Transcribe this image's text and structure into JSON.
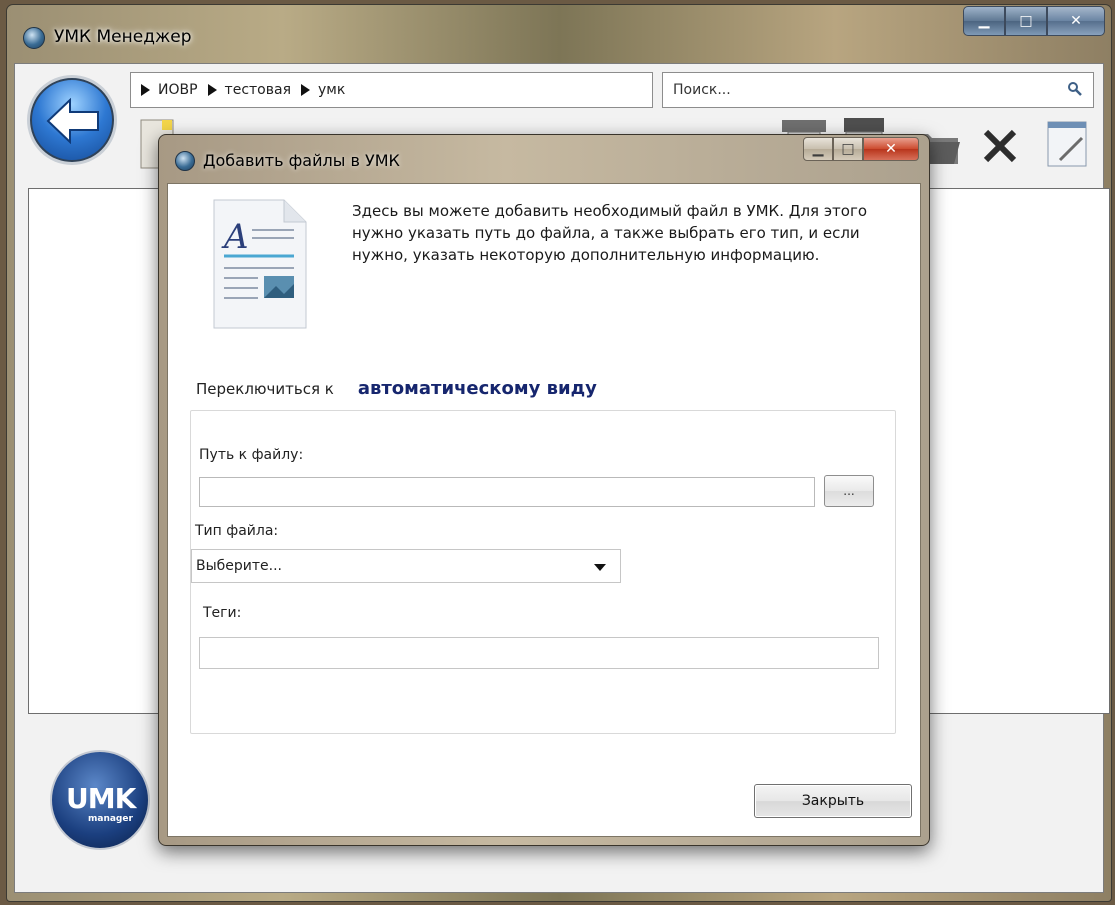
{
  "window": {
    "title": "УМК Менеджер"
  },
  "nav": {
    "crumbs": [
      "ИОВР",
      "тестовая",
      "умк"
    ],
    "search_placeholder": "Поиск..."
  },
  "logo": {
    "text": "UMK",
    "sub": "manager"
  },
  "dialog": {
    "title": "Добавить файлы в УМК",
    "intro": "Здесь вы можете добавить необходимый файл в УМК. Для этого нужно указать путь до файла, а также выбрать его тип, и если нужно, указать некоторую дополнительную информацию.",
    "switch_label": "Переключиться к",
    "switch_link": "автоматическому виду",
    "path_label": "Путь к файлу:",
    "browse_label": "...",
    "type_label": "Тип файла:",
    "type_selected": "Выберите...",
    "tags_label": "Теги:",
    "close_label": "Закрыть"
  },
  "colors": {
    "link": "#16266e",
    "accent": "#2e78d2"
  }
}
